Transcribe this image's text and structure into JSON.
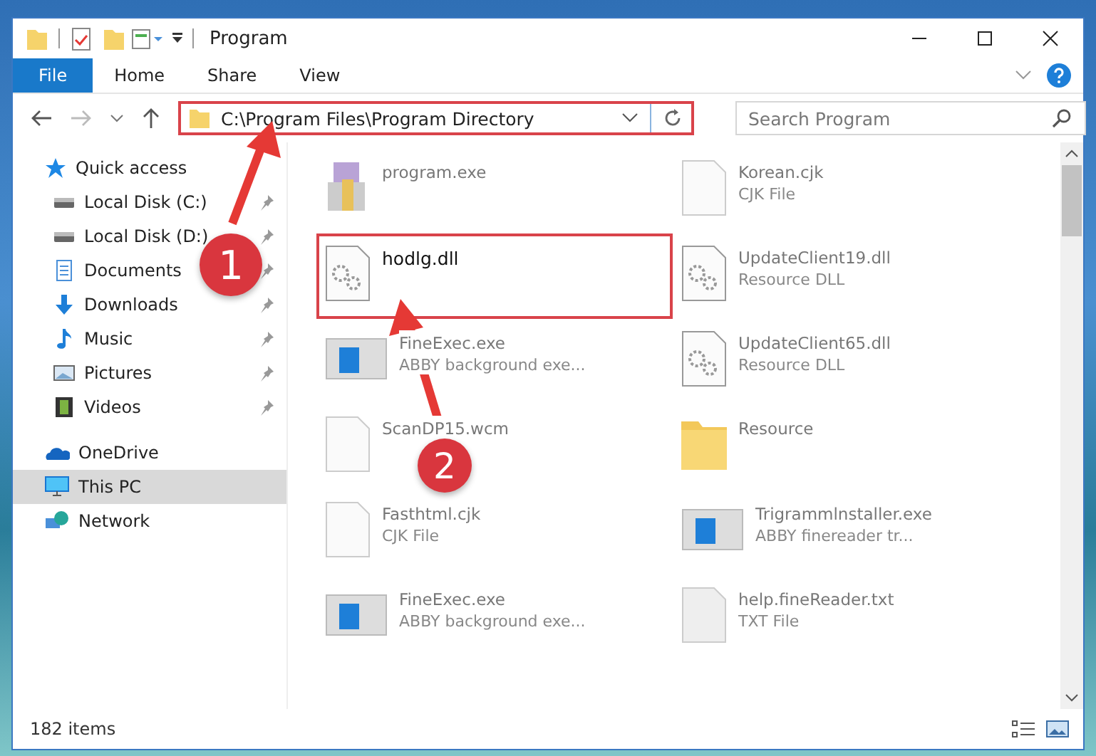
{
  "window": {
    "title": "Program"
  },
  "ribbon_tabs": [
    {
      "label": "File",
      "selected": true
    },
    {
      "label": "Home",
      "selected": false
    },
    {
      "label": "Share",
      "selected": false
    },
    {
      "label": "View",
      "selected": false
    }
  ],
  "address": {
    "path": "C:\\Program Files\\Program Directory"
  },
  "search": {
    "placeholder": "Search Program"
  },
  "sidebar": {
    "items": [
      {
        "label": "Quick access",
        "kind": "star",
        "pinned": false,
        "selected": false,
        "children": [
          {
            "label": "Local Disk (C:)",
            "kind": "disk",
            "pinned": true,
            "selected": false
          },
          {
            "label": "Local Disk (D:)",
            "kind": "disk",
            "pinned": true,
            "selected": false
          },
          {
            "label": "Documents",
            "kind": "docs",
            "pinned": true,
            "selected": false
          },
          {
            "label": "Downloads",
            "kind": "download",
            "pinned": true,
            "selected": false
          },
          {
            "label": "Music",
            "kind": "music",
            "pinned": true,
            "selected": false
          },
          {
            "label": "Pictures",
            "kind": "pictures",
            "pinned": true,
            "selected": false
          },
          {
            "label": "Videos",
            "kind": "videos",
            "pinned": true,
            "selected": false
          }
        ]
      },
      {
        "label": "OneDrive",
        "kind": "cloud",
        "pinned": false,
        "selected": false
      },
      {
        "label": "This PC",
        "kind": "pc",
        "pinned": false,
        "selected": true
      },
      {
        "label": "Network",
        "kind": "network",
        "pinned": false,
        "selected": false
      }
    ]
  },
  "files": [
    {
      "name": "program.exe",
      "kind": "installer",
      "highlighted": false
    },
    {
      "name": "Korean.cjk",
      "type": "CJK File",
      "kind": "blank",
      "highlighted": false
    },
    {
      "name": "hodlg.dll",
      "kind": "dll",
      "highlighted": true
    },
    {
      "name": "UpdateClient19.dll",
      "type": "Resource DLL",
      "kind": "dll",
      "highlighted": false
    },
    {
      "name": "FineExec.exe",
      "type": "ABBY background exe...",
      "kind": "app",
      "highlighted": false
    },
    {
      "name": "UpdateClient65.dll",
      "type": "Resource DLL",
      "kind": "dll",
      "highlighted": false
    },
    {
      "name": "ScanDP15.wcm",
      "kind": "blank",
      "highlighted": false
    },
    {
      "name": "Resource",
      "kind": "folder",
      "highlighted": false
    },
    {
      "name": "Fasthtml.cjk",
      "type": "CJK File",
      "kind": "blank",
      "highlighted": false
    },
    {
      "name": "Trigrammlnstaller.exe",
      "type": "ABBY finereader tr...",
      "kind": "app",
      "highlighted": false
    },
    {
      "name": "FineExec.exe",
      "type": "ABBY background exe...",
      "kind": "app",
      "highlighted": false
    },
    {
      "name": "help.fineReader.txt",
      "type": "TXT File",
      "kind": "text",
      "highlighted": false
    }
  ],
  "status_bar": {
    "count": "182 items"
  },
  "annotations": [
    {
      "number": "1"
    },
    {
      "number": "2"
    }
  ]
}
